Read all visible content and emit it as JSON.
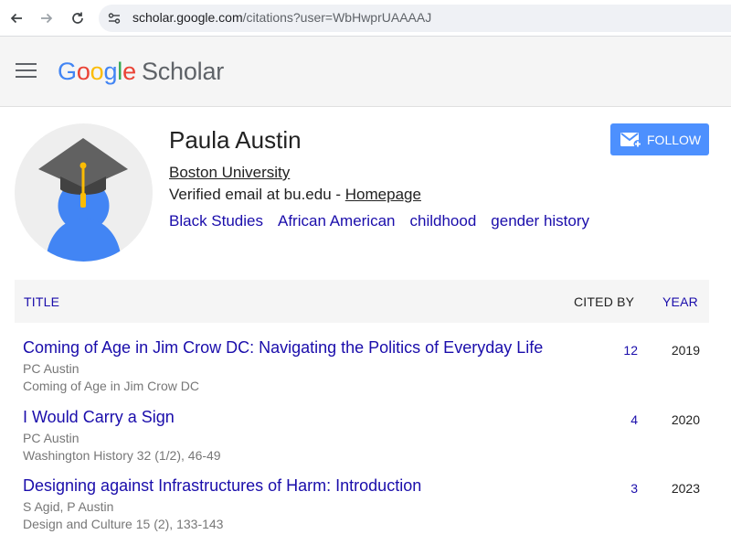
{
  "browser": {
    "url_host": "scholar.google.com",
    "url_path": "/citations?user=WbHwprUAAAAJ"
  },
  "header": {
    "logo_letters": [
      "G",
      "o",
      "o",
      "g",
      "l",
      "e"
    ],
    "logo_scholar": "Scholar"
  },
  "profile": {
    "name": "Paula Austin",
    "affiliation": "Boston University",
    "email_text": "Verified email at bu.edu - ",
    "homepage_label": "Homepage",
    "interests": [
      "Black Studies",
      "African American",
      "childhood",
      "gender history"
    ],
    "follow_label": "FOLLOW"
  },
  "table": {
    "headers": {
      "title": "TITLE",
      "cited_by": "CITED BY",
      "year": "YEAR"
    },
    "rows": [
      {
        "title": "Coming of Age in Jim Crow DC: Navigating the Politics of Everyday Life",
        "authors": "PC Austin",
        "venue": "Coming of Age in Jim Crow DC",
        "cited_by": "12",
        "year": "2019"
      },
      {
        "title": "I Would Carry a Sign",
        "authors": "PC Austin",
        "venue": "Washington History 32 (1/2), 46-49",
        "cited_by": "4",
        "year": "2020"
      },
      {
        "title": "Designing against Infrastructures of Harm: Introduction",
        "authors": "S Agid, P Austin",
        "venue": "Design and Culture 15 (2), 133-143",
        "cited_by": "3",
        "year": "2023"
      }
    ]
  },
  "colors": {
    "link": "#1a0dab",
    "follow_button": "#4d90fe",
    "header_bg": "#f5f5f5"
  },
  "icons": [
    "back-arrow-icon",
    "forward-arrow-icon",
    "reload-icon",
    "site-settings-icon",
    "menu-icon",
    "graduation-cap-avatar-icon",
    "follow-mail-icon"
  ]
}
